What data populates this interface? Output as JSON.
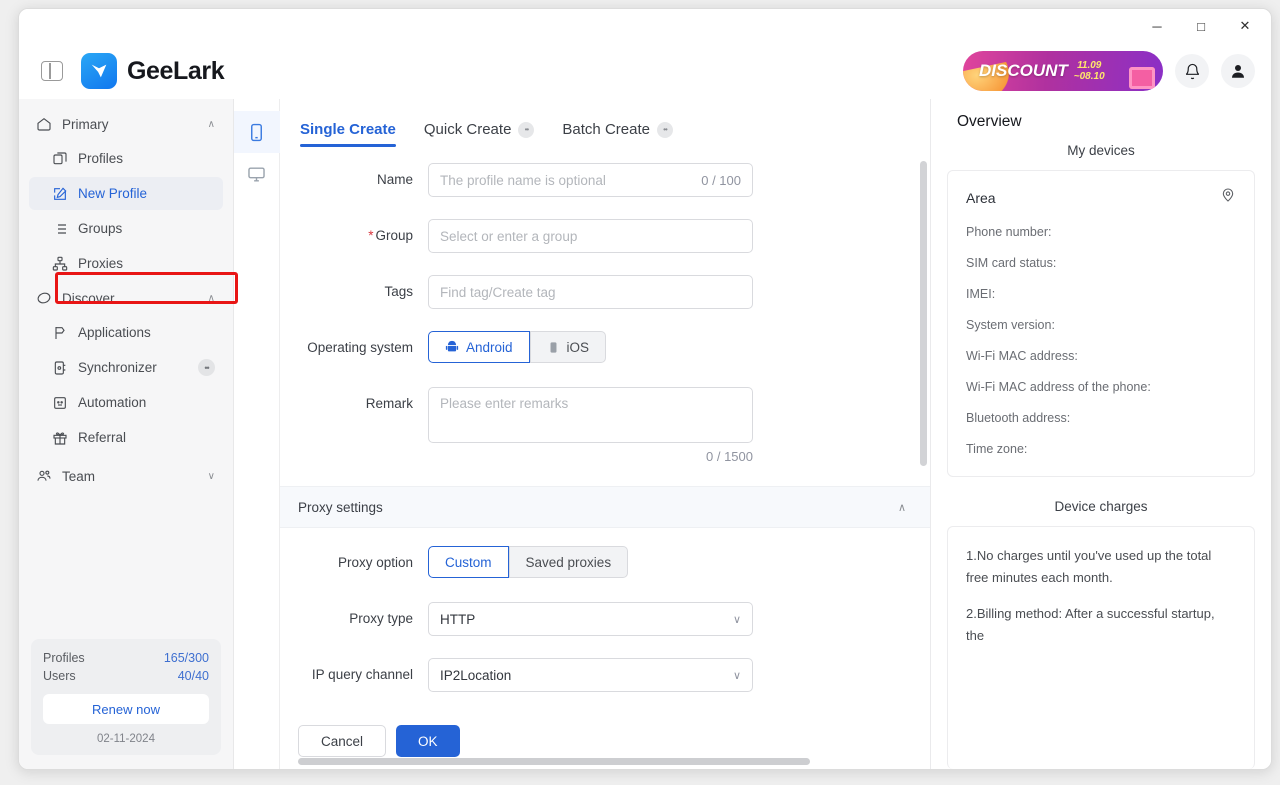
{
  "window": {
    "minimize_label": "─",
    "maximize_label": "□",
    "close_label": "✕"
  },
  "header": {
    "brand": "GeeLark",
    "promo_text": "DISCOUNT",
    "promo_date_start": "11.09",
    "promo_date_end": "~08.10"
  },
  "sidebar": {
    "groups": [
      {
        "label": "Primary",
        "chevron": "∧",
        "items": [
          {
            "label": "Profiles",
            "active": false
          },
          {
            "label": "New Profile",
            "active": true
          },
          {
            "label": "Groups",
            "active": false
          },
          {
            "label": "Proxies",
            "active": false
          }
        ]
      },
      {
        "label": "Discover",
        "chevron": "∧",
        "items": [
          {
            "label": "Applications",
            "active": false
          },
          {
            "label": "Synchronizer",
            "active": false,
            "badge": "••"
          },
          {
            "label": "Automation",
            "active": false
          },
          {
            "label": "Referral",
            "active": false
          }
        ]
      }
    ],
    "team": {
      "label": "Team",
      "chevron": "∨"
    },
    "footer": {
      "profiles_label": "Profiles",
      "profiles_value": "165/300",
      "users_label": "Users",
      "users_value": "40/40",
      "renew_label": "Renew now",
      "expiry": "02-11-2024"
    }
  },
  "rail": {
    "phone_icon": "phone-icon",
    "desktop_icon": "desktop-icon"
  },
  "tabs": [
    {
      "label": "Single Create",
      "active": true,
      "badge": null
    },
    {
      "label": "Quick Create",
      "active": false,
      "badge": "••"
    },
    {
      "label": "Batch Create",
      "active": false,
      "badge": "••"
    }
  ],
  "form": {
    "name": {
      "label": "Name",
      "placeholder": "The profile name is optional",
      "value": "",
      "counter": "0 / 100"
    },
    "group": {
      "label": "Group",
      "required_mark": "*",
      "placeholder": "Select or enter a group",
      "value": ""
    },
    "tags": {
      "label": "Tags",
      "placeholder": "Find tag/Create tag",
      "value": ""
    },
    "operating_system": {
      "label": "Operating system",
      "options": [
        {
          "label": "Android",
          "selected": true
        },
        {
          "label": "iOS",
          "selected": false
        }
      ]
    },
    "remark": {
      "label": "Remark",
      "placeholder": "Please enter remarks",
      "value": "",
      "counter": "0 / 1500"
    },
    "proxy_section": {
      "title": "Proxy settings",
      "chevron": "∧"
    },
    "proxy_option": {
      "label": "Proxy option",
      "options": [
        {
          "label": "Custom",
          "selected": true
        },
        {
          "label": "Saved proxies",
          "selected": false
        }
      ]
    },
    "proxy_type": {
      "label": "Proxy type",
      "value": "HTTP",
      "chevron": "∨"
    },
    "ip_query_channel": {
      "label": "IP query channel",
      "value": "IP2Location",
      "chevron": "∨"
    }
  },
  "footer": {
    "cancel_label": "Cancel",
    "ok_label": "OK"
  },
  "overview": {
    "title": "Overview",
    "devices_heading": "My devices",
    "area_label": "Area",
    "fields": [
      "Phone number:",
      "SIM card status:",
      "IMEI:",
      "System version:",
      "Wi-Fi MAC address:",
      "Wi-Fi MAC address of the phone:",
      "Bluetooth address:",
      "Time zone:"
    ],
    "charges_heading": "Device charges",
    "charges_lines": [
      "1.No charges until you've used up the total free minutes each month.",
      "2.Billing method: After a successful startup, the"
    ]
  },
  "colors": {
    "accent": "#2563d6",
    "annotation": "#e81515",
    "sidebar_bg": "#f6f6f7"
  }
}
